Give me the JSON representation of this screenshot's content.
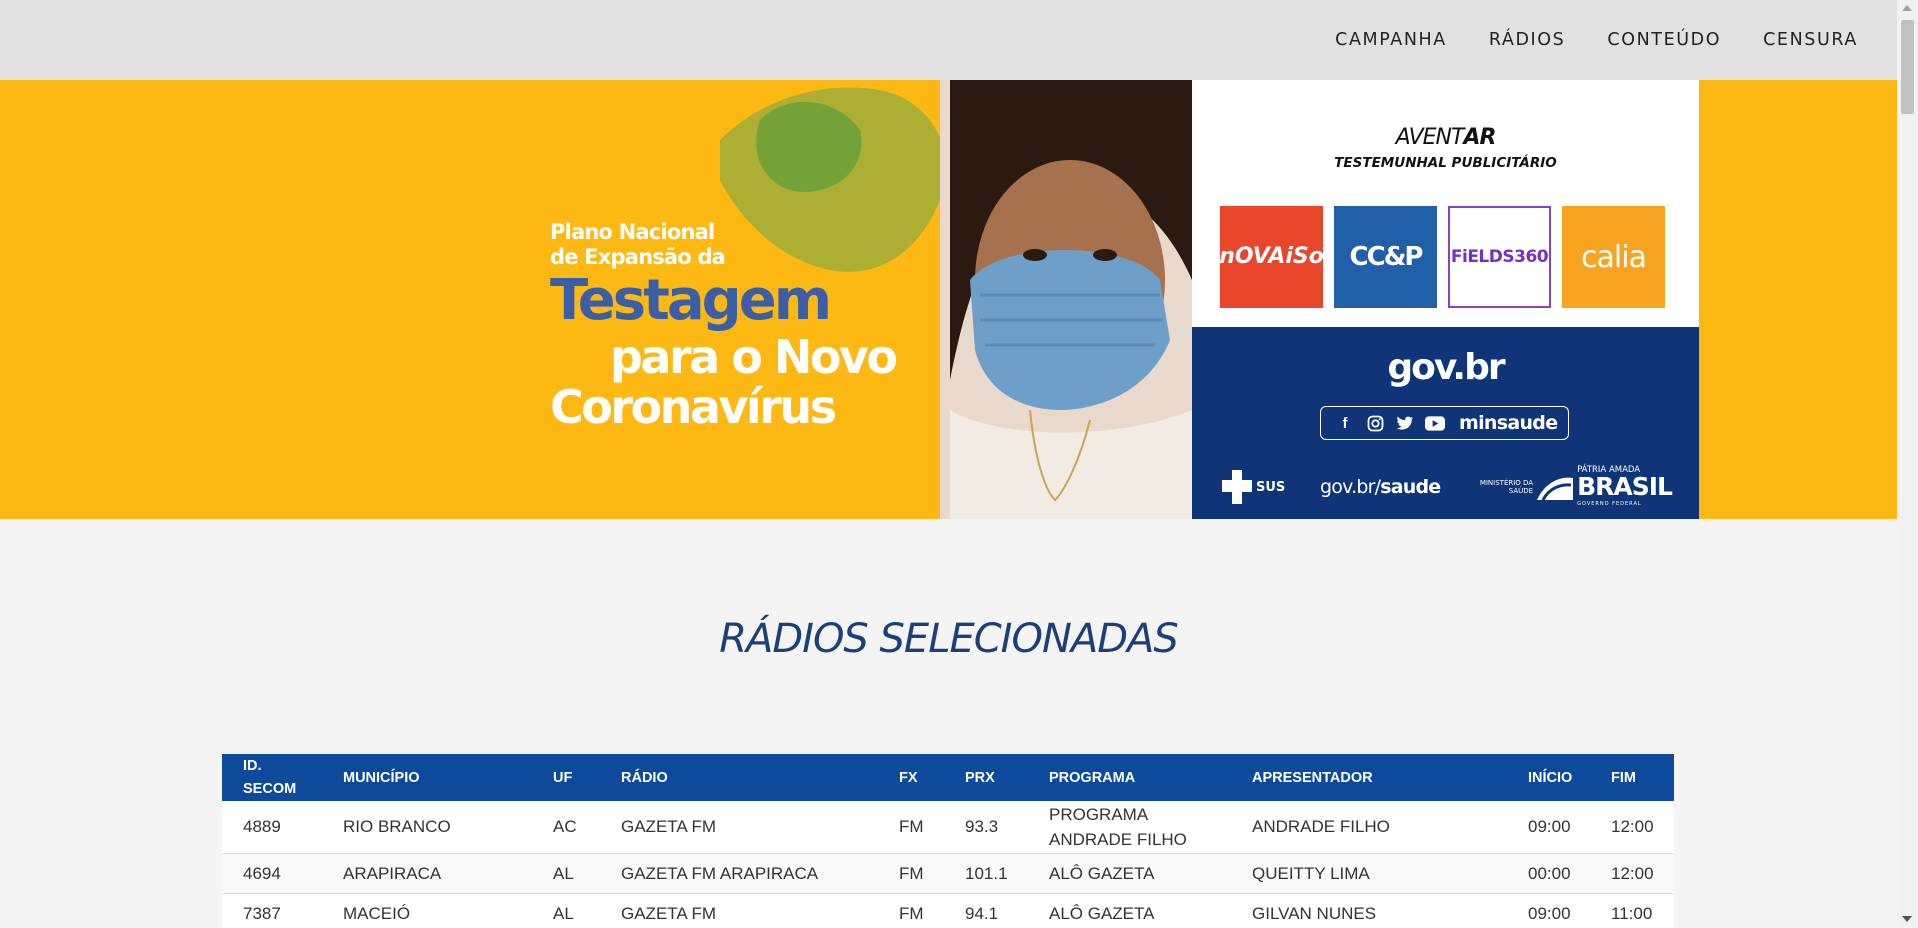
{
  "nav": {
    "items": [
      "CAMPANHA",
      "RÁDIOS",
      "CONTEÚDO",
      "CENSURA"
    ]
  },
  "banner": {
    "headline_line1": "Plano Nacional",
    "headline_line2": "de Expansão da",
    "headline_big": "Testagem",
    "headline_line3": "para o Novo",
    "headline_line4": "Coronavírus",
    "aventar_light": "AVENT",
    "aventar_bold": "AR",
    "testemunhal": "TESTEMUNHAL PUBLICITÁRIO",
    "logos": [
      "nOVAiSo",
      "CC&P",
      "FiELDS360",
      "calia"
    ],
    "govbr": "gov.br",
    "social_handle": "minsaude",
    "sus": "SUS",
    "govbr_saude_prefix": "gov.br/",
    "govbr_saude_bold": "saude",
    "ministerio": "MINISTÉRIO DA SAÚDE",
    "patria_amada": "PÁTRIA AMADA",
    "brasil": "BRASIL",
    "governo_federal": "GOVERNO FEDERAL",
    "colors": {
      "yellow": "#fdb813",
      "gov_blue": "#0f3578",
      "headline_blue": "#3b5fa7"
    }
  },
  "section": {
    "title": "RÁDIOS SELECIONADAS"
  },
  "table": {
    "headers": {
      "id_line1": "ID.",
      "id_line2": "SECOM",
      "municipio": "MUNICÍPIO",
      "uf": "UF",
      "radio": "RÁDIO",
      "fx": "FX",
      "prx": "PRX",
      "programa": "PROGRAMA",
      "apresentador": "APRESENTADOR",
      "inicio": "INÍCIO",
      "fim": "FIM"
    },
    "rows": [
      {
        "id": "4889",
        "municipio": "RIO BRANCO",
        "uf": "AC",
        "radio": "GAZETA FM",
        "fx": "FM",
        "prx": "93.3",
        "programa_l1": "PROGRAMA",
        "programa_l2": "ANDRADE FILHO",
        "apresentador": "ANDRADE FILHO",
        "inicio": "09:00",
        "fim": "12:00"
      },
      {
        "id": "4694",
        "municipio": "ARAPIRACA",
        "uf": "AL",
        "radio": "GAZETA FM ARAPIRACA",
        "fx": "FM",
        "prx": "101.1",
        "programa_l1": "ALÔ GAZETA",
        "programa_l2": "",
        "apresentador": "QUEITTY LIMA",
        "inicio": "00:00",
        "fim": "12:00"
      },
      {
        "id": "7387",
        "municipio": "MACEIÓ",
        "uf": "AL",
        "radio": "GAZETA FM",
        "fx": "FM",
        "prx": "94.1",
        "programa_l1": "ALÔ GAZETA",
        "programa_l2": "",
        "apresentador": "GILVAN NUNES",
        "inicio": "09:00",
        "fim": "11:00"
      }
    ],
    "header_color": "#0e4a9c"
  }
}
